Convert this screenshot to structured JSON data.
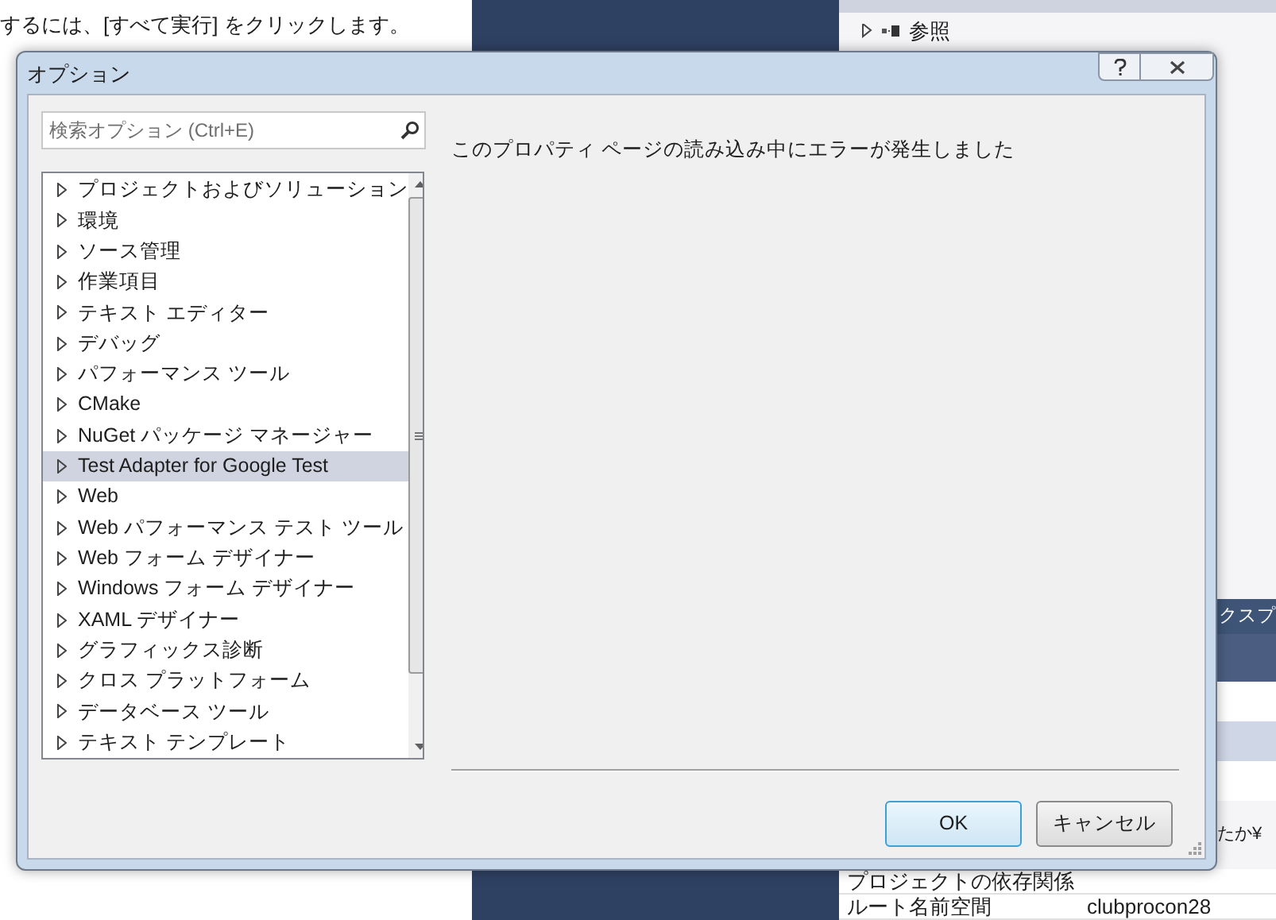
{
  "background_page": {
    "instruction": "するには、[すべて実行] をクリックします。"
  },
  "solution_explorer": {
    "items": [
      {
        "label": "参照",
        "expanded": false
      }
    ]
  },
  "properties": {
    "header": "クスプ",
    "path_fragment": "たか¥",
    "rows": [
      {
        "name": "プロジェクトの依存関係",
        "value": ""
      },
      {
        "name": "ルート名前空間",
        "value": "clubprocon28"
      }
    ]
  },
  "dialog": {
    "title": "オプション",
    "search": {
      "placeholder": "検索オプション (Ctrl+E)"
    },
    "tree": [
      {
        "label": "プロジェクトおよびソリューション",
        "selected": false
      },
      {
        "label": "環境",
        "selected": false
      },
      {
        "label": "ソース管理",
        "selected": false
      },
      {
        "label": "作業項目",
        "selected": false
      },
      {
        "label": "テキスト エディター",
        "selected": false
      },
      {
        "label": "デバッグ",
        "selected": false
      },
      {
        "label": "パフォーマンス ツール",
        "selected": false
      },
      {
        "label": "CMake",
        "selected": false
      },
      {
        "label": "NuGet パッケージ マネージャー",
        "selected": false
      },
      {
        "label": "Test Adapter for Google Test",
        "selected": true
      },
      {
        "label": "Web",
        "selected": false
      },
      {
        "label": "Web パフォーマンス テスト ツール",
        "selected": false
      },
      {
        "label": "Web フォーム デザイナー",
        "selected": false
      },
      {
        "label": "Windows フォーム デザイナー",
        "selected": false
      },
      {
        "label": "XAML デザイナー",
        "selected": false
      },
      {
        "label": "グラフィックス診断",
        "selected": false
      },
      {
        "label": "クロス プラットフォーム",
        "selected": false
      },
      {
        "label": "データベース ツール",
        "selected": false
      },
      {
        "label": "テキスト テンプレート",
        "selected": false
      }
    ],
    "message": "このプロパティ ページの読み込み中にエラーが発生しました",
    "buttons": [
      {
        "label": "OK",
        "default": true
      },
      {
        "label": "キャンセル",
        "default": false
      }
    ]
  }
}
